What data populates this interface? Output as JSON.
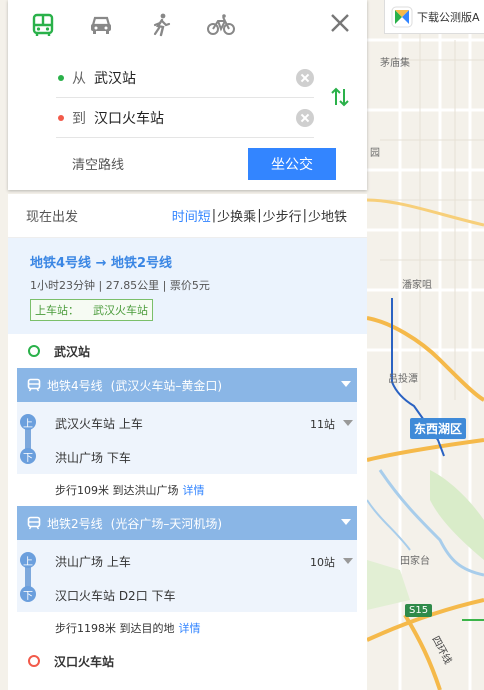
{
  "map": {
    "banner_text": "下载公测版A",
    "labels": [
      "茅庙集",
      "园",
      "潘家咀",
      "吕投潭",
      "田家台"
    ],
    "district": "东西湖区",
    "highway_code": "S15",
    "ring_road": "四环线"
  },
  "modes": [
    {
      "name": "bus",
      "icon": "bus-icon",
      "active": true
    },
    {
      "name": "car",
      "icon": "car-icon",
      "active": false
    },
    {
      "name": "walk",
      "icon": "walk-icon",
      "active": false
    },
    {
      "name": "bike",
      "icon": "bike-icon",
      "active": false
    }
  ],
  "route_form": {
    "from_prefix": "从",
    "from_value": "武汉站",
    "to_prefix": "到",
    "to_value": "汉口火车站",
    "clear_label": "清空路线",
    "search_label": "坐公交"
  },
  "filters": {
    "now": "现在出发",
    "sorts": [
      "时间短",
      "少换乘",
      "少步行",
      "少地铁"
    ],
    "active": "时间短",
    "separator": "|"
  },
  "summary": {
    "title": "地铁4号线 → 地铁2号线",
    "meta": "1小时23分钟 | 27.85公里 | 票价5元",
    "boarding_label": "上车站：",
    "boarding_station": "武汉火车站"
  },
  "detail": {
    "start": "武汉站",
    "end": "汉口火车站",
    "legs": [
      {
        "line": "地铁4号线",
        "range": "(武汉火车站–黄金口)",
        "board_badge": "上",
        "board": "武汉火车站 上车",
        "alight_badge": "下",
        "alight": "洪山广场 下车",
        "stops": "11站",
        "walk": "步行109米 到达洪山广场",
        "walk_more": "详情"
      },
      {
        "line": "地铁2号线",
        "range": "(光谷广场–天河机场)",
        "board_badge": "上",
        "board": "洪山广场 上车",
        "alight_badge": "下",
        "alight": "汉口火车站 D2口 下车",
        "stops": "10站",
        "walk": "步行1198米 到达目的地",
        "walk_more": "详情"
      }
    ]
  },
  "colors": {
    "primary": "#3385ff",
    "bus_mode_active": "#2ab14a",
    "start_dot": "#2ab14a",
    "end_dot": "#f25a4a",
    "subway_line": "#8ab6e6"
  }
}
